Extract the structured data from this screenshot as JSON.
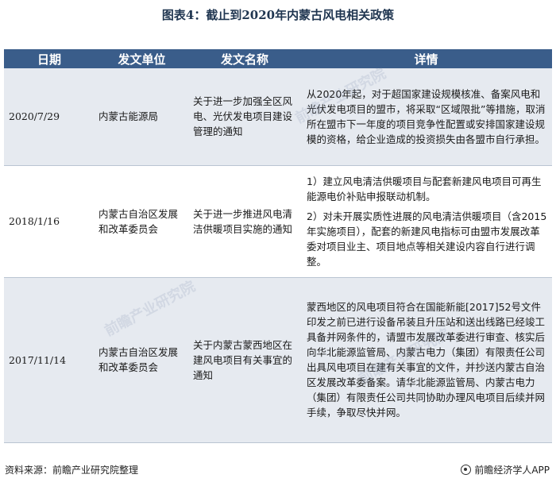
{
  "title": "图表4：截止到2020年内蒙古风电相关政策",
  "table": {
    "headers": [
      "日期",
      "发文单位",
      "发文名称",
      "详情"
    ],
    "rows": [
      {
        "date": "2020/7/29",
        "issuer": "内蒙古能源局",
        "name": "关于进一步加强全区风电、光伏发电项目建设管理的通知",
        "details": [
          "从2020年起，对于超国家建设规模核准、备案风电和光伏发电项目的盟市，将采取“区域限批”等措施，取消所在盟市下一年度的项目竞争性配置或安排国家建设规模的资格，给企业造成的投资损失由各盟市自行承担。"
        ]
      },
      {
        "date": "2018/1/16",
        "issuer": "内蒙古自治区发展和改革委员会",
        "name": "关于进一步推进风电清洁供暖项目实施的通知",
        "details": [
          "1）建立风电清洁供暖项目与配套新建风电项目可再生能源电价补贴申报联动机制。",
          "2）对未开展实质性进展的风电清洁供暖项目（含2015年实施项目），配套的新建风电指标可由盟市发展改革委对项目业主、项目地点等相关建设内容自行进行调整。"
        ]
      },
      {
        "date": "2017/11/14",
        "issuer": "内蒙古自治区发展和改革委员会",
        "name": "关于内蒙古蒙西地区在建风电项目有关事宜的通知",
        "details": [
          "蒙西地区的风电项目符合在国能新能[2017]52号文件印发之前已进行设备吊装且升压站和送出线路已经竣工具备并网条件的，请盟市发展改革委进行审查、核实后向华北能源监管局、内蒙古电力（集团）有限责任公司出具风电项目在建有关事宜的文件，并抄送内蒙古自治区发展改革委备案。请华北能源监管局、内蒙古电力（集团）有限责任公司共同协助办理风电项目后续并网手续，争取尽快并网。"
        ]
      }
    ]
  },
  "footer": {
    "source": "资料来源：前瞻产业研究院整理",
    "brand_icon": "qianzhan-logo-icon",
    "brand": "前瞻经济学人APP"
  },
  "watermark": "前瞻产业研究院"
}
